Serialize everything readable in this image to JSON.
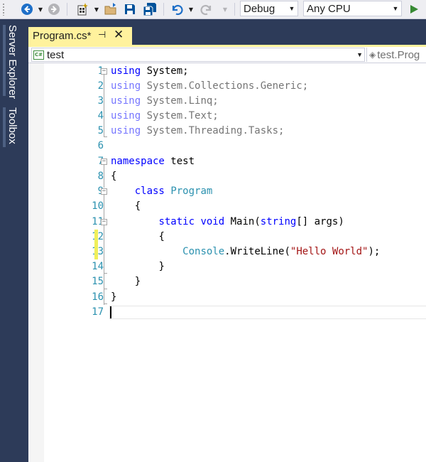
{
  "toolbar": {
    "config_value": "Debug",
    "platform_value": "Any CPU",
    "icons": [
      "back-icon",
      "forward-icon",
      "new-project-icon",
      "open-icon",
      "save-icon",
      "save-all-icon",
      "undo-icon",
      "redo-icon",
      "start-icon"
    ]
  },
  "side_panel": {
    "tabs": [
      {
        "label": "Server Explorer"
      },
      {
        "label": "Toolbox"
      }
    ]
  },
  "document_tab": {
    "label": "Program.cs*"
  },
  "navbar": {
    "project": "test",
    "type": "test.Prog"
  },
  "editor": {
    "line_numbers": [
      "1",
      "2",
      "3",
      "4",
      "5",
      "6",
      "7",
      "8",
      "9",
      "10",
      "11",
      "12",
      "13",
      "14",
      "15",
      "16",
      "17"
    ],
    "lines": {
      "l1": {
        "kw": "using",
        "rest": " System;"
      },
      "l2": {
        "kw": "using",
        "rest": " System.Collections.Generic;"
      },
      "l3": {
        "kw": "using",
        "rest": " System.Linq;"
      },
      "l4": {
        "kw": "using",
        "rest": " System.Text;"
      },
      "l5": {
        "kw": "using",
        "rest": " System.Threading.Tasks;"
      },
      "l7": {
        "kw": "namespace",
        "rest": " test"
      },
      "l8": {
        "text": "{"
      },
      "l9": {
        "indent": "    ",
        "kw": "class",
        "type": "Program"
      },
      "l10": {
        "indent": "    ",
        "text": "{"
      },
      "l11": {
        "indent": "        ",
        "kw1": "static",
        "kw2": "void",
        "name": "Main(",
        "kw3": "string",
        "rest": "[] args)"
      },
      "l12": {
        "indent": "        ",
        "text": "{"
      },
      "l13": {
        "indent": "            ",
        "type": "Console",
        "call": ".WriteLine(",
        "str": "\"Hello World\"",
        "end": ");"
      },
      "l14": {
        "indent": "        ",
        "text": "}"
      },
      "l15": {
        "indent": "    ",
        "text": "}"
      },
      "l16": {
        "text": "}"
      }
    }
  },
  "colors": {
    "keyword": "#0000ff",
    "type": "#2b91af",
    "string": "#a31515",
    "line_number": "#2b91af",
    "active_tab": "#fff29d",
    "side_panel": "#2d3b59"
  }
}
